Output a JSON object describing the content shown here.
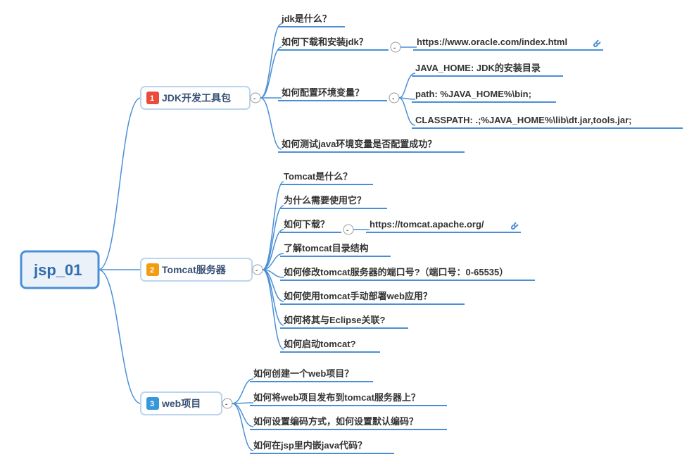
{
  "root": "jsp_01",
  "branches": [
    {
      "num": "1",
      "label": "JDK开发工具包",
      "children": [
        {
          "label": "jdk是什么？"
        },
        {
          "label": "如何下载和安装jdk？",
          "children": [
            {
              "label": "https://www.oracle.com/index.html",
              "link": true
            }
          ]
        },
        {
          "label": "如何配置环境变量？",
          "children": [
            {
              "label": "JAVA_HOME: JDK的安装目录"
            },
            {
              "label": "path: %JAVA_HOME%\\bin;"
            },
            {
              "label": "CLASSPATH:  .;%JAVA_HOME%\\lib\\dt.jar,tools.jar;"
            }
          ]
        },
        {
          "label": "如何测试java环境变量是否配置成功？"
        }
      ]
    },
    {
      "num": "2",
      "label": "Tomcat服务器",
      "children": [
        {
          "label": "Tomcat是什么？"
        },
        {
          "label": "为什么需要使用它？"
        },
        {
          "label": "如何下载？",
          "children": [
            {
              "label": "https://tomcat.apache.org/",
              "link": true
            }
          ]
        },
        {
          "label": "了解tomcat目录结构"
        },
        {
          "label": "如何修改tomcat服务器的端口号?（端口号：0-65535）"
        },
        {
          "label": "如何使用tomcat手动部署web应用？"
        },
        {
          "label": "如何将其与Eclipse关联?"
        },
        {
          "label": "如何启动tomcat?"
        }
      ]
    },
    {
      "num": "3",
      "label": "web项目",
      "children": [
        {
          "label": "如何创建一个web项目？"
        },
        {
          "label": "如何将web项目发布到tomcat服务器上？"
        },
        {
          "label": "如何设置编码方式，如何设置默认编码？"
        },
        {
          "label": "如何在jsp里内嵌java代码？"
        }
      ]
    }
  ]
}
